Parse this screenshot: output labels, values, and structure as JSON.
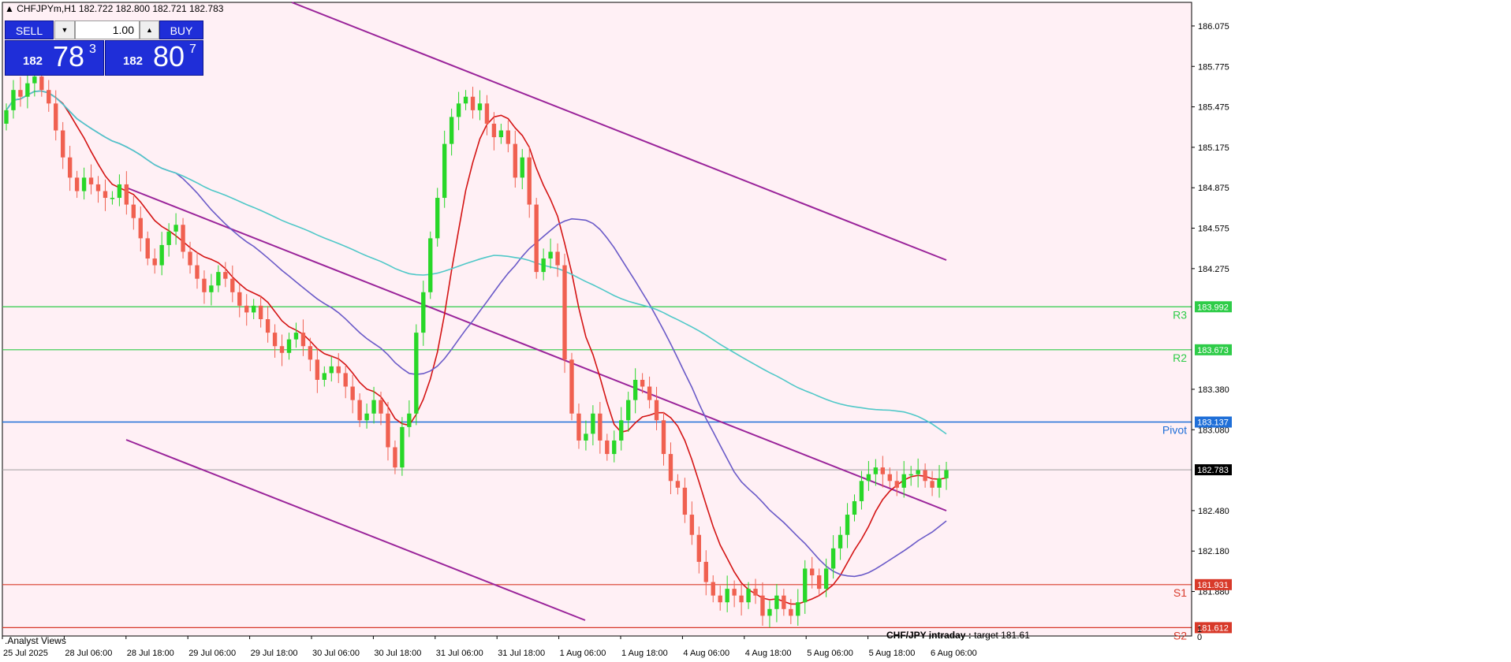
{
  "header": {
    "symbol": "CHFJPYm,H1",
    "ohlc": "182.722 182.800 182.721 182.783"
  },
  "trade_panel": {
    "sell_label": "SELL",
    "buy_label": "BUY",
    "lot": "1.00",
    "sell_price": {
      "prefix": "182",
      "big": "78",
      "sup": "3"
    },
    "buy_price": {
      "prefix": "182",
      "big": "80",
      "sup": "7"
    }
  },
  "footer": {
    "analyst_views": ".Analyst Views",
    "intraday_label": "CHF/JPY intraday :",
    "intraday_target": "target 181.61"
  },
  "colors": {
    "background": "#fff0f5",
    "bull": "#28d728",
    "bear": "#f06050",
    "ma_fast": "#d41414",
    "ma_mid": "#6a5ac8",
    "ma_slow": "#50c8c8",
    "channel": "#9a249a",
    "resistance": "#2ecc48",
    "pivot": "#1f6fd8",
    "support": "#d83a2a"
  },
  "chart_data": {
    "type": "candlestick",
    "symbol": "CHFJPYm",
    "timeframe": "H1",
    "ylim": [
      181.55,
      186.25
    ],
    "y_ticks": [
      "186.075",
      "185.775",
      "185.475",
      "185.175",
      "184.875",
      "184.575",
      "184.275",
      "183.380",
      "183.080",
      "182.480",
      "182.180",
      "181.880"
    ],
    "x_ticks": [
      "25 Jul 2025",
      "28 Jul 06:00",
      "28 Jul 18:00",
      "29 Jul 06:00",
      "29 Jul 18:00",
      "30 Jul 06:00",
      "30 Jul 18:00",
      "31 Jul 06:00",
      "31 Jul 18:00",
      "1 Aug 06:00",
      "1 Aug 18:00",
      "4 Aug 06:00",
      "4 Aug 18:00",
      "5 Aug 06:00",
      "5 Aug 18:00",
      "6 Aug 06:00"
    ],
    "levels": [
      {
        "name": "R3",
        "value": 183.992,
        "label": "183.992",
        "kind": "resistance"
      },
      {
        "name": "R2",
        "value": 183.673,
        "label": "183.673",
        "kind": "resistance"
      },
      {
        "name": "Pivot",
        "value": 183.137,
        "label": "183.137",
        "kind": "pivot"
      },
      {
        "name": "S1",
        "value": 181.931,
        "label": "181.931",
        "kind": "support"
      },
      {
        "name": "S2",
        "value": 181.612,
        "label": "181.612",
        "kind": "support"
      }
    ],
    "current_price": {
      "value": 182.783,
      "label": "182.783"
    },
    "closes": [
      185.45,
      185.6,
      185.55,
      185.65,
      185.7,
      185.6,
      185.5,
      185.3,
      185.1,
      184.95,
      184.85,
      184.95,
      184.9,
      184.85,
      184.8,
      184.8,
      184.9,
      184.75,
      184.65,
      184.5,
      184.35,
      184.3,
      184.45,
      184.55,
      184.6,
      184.4,
      184.3,
      184.2,
      184.1,
      184.15,
      184.25,
      184.2,
      184.1,
      184.0,
      183.95,
      184.0,
      183.9,
      183.8,
      183.7,
      183.65,
      183.75,
      183.8,
      183.7,
      183.6,
      183.45,
      183.5,
      183.55,
      183.5,
      183.4,
      183.3,
      183.15,
      183.2,
      183.3,
      183.2,
      182.95,
      182.8,
      183.1,
      183.2,
      183.8,
      184.1,
      184.5,
      184.8,
      185.2,
      185.4,
      185.5,
      185.55,
      185.45,
      185.5,
      185.35,
      185.25,
      185.3,
      185.2,
      184.95,
      185.1,
      184.75,
      184.25,
      184.35,
      184.4,
      184.3,
      183.6,
      183.2,
      183.0,
      183.05,
      183.2,
      183.0,
      182.9,
      183.0,
      183.15,
      183.3,
      183.45,
      183.4,
      183.3,
      183.15,
      182.9,
      182.7,
      182.65,
      182.45,
      182.3,
      182.1,
      181.95,
      181.85,
      181.8,
      181.9,
      181.85,
      181.8,
      181.9,
      181.85,
      181.7,
      181.75,
      181.85,
      181.75,
      181.7,
      181.8,
      182.05,
      182.0,
      181.9,
      182.05,
      182.2,
      182.3,
      182.45,
      182.55,
      182.7,
      182.75,
      182.8,
      182.75,
      182.7,
      182.65,
      182.75,
      182.75,
      182.78,
      182.7,
      182.65,
      182.72,
      182.78
    ]
  }
}
